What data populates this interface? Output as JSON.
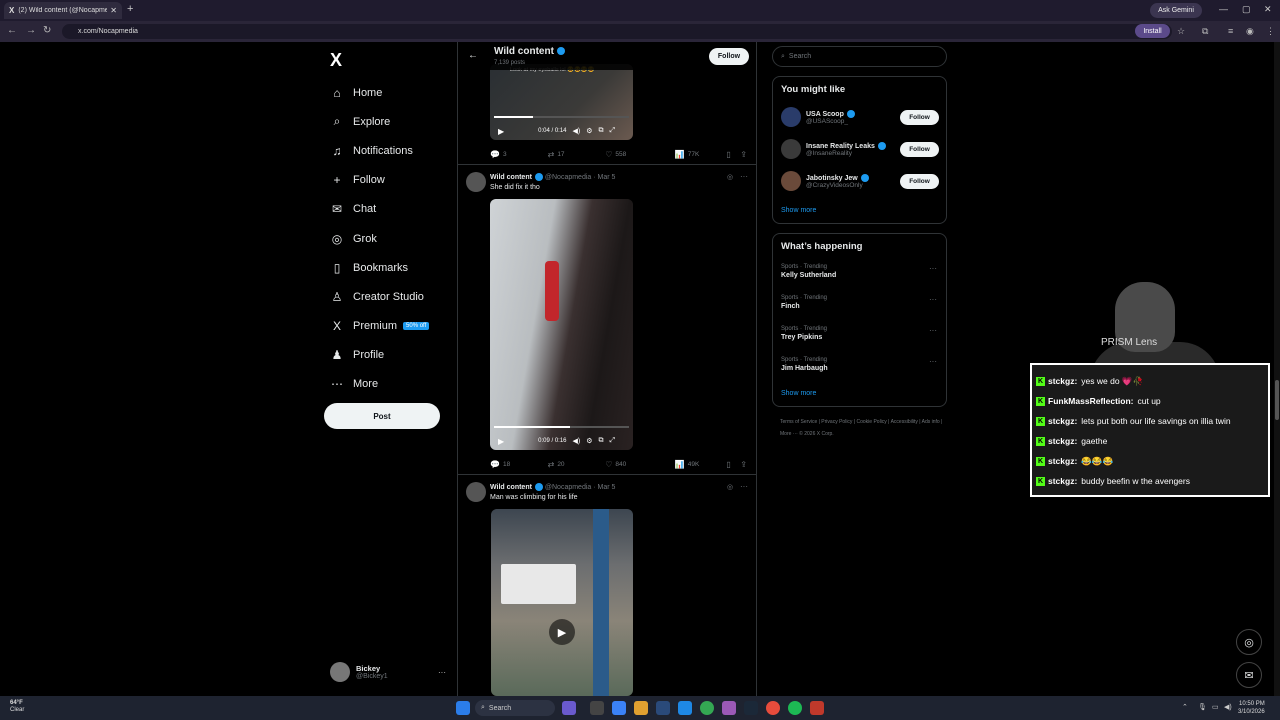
{
  "browser": {
    "tab_title": "(2) Wild content (@Nocapmedia) / X",
    "tab_icon": "X",
    "new_tab": "+",
    "ask_gemini": "Ask Gemini",
    "url": "x.com/Nocapmedia",
    "install": "Install"
  },
  "sidebar": {
    "logo": "X",
    "items": [
      {
        "label": "Home",
        "icon": "⌂"
      },
      {
        "label": "Explore",
        "icon": "⌕"
      },
      {
        "label": "Notifications",
        "icon": "♫"
      },
      {
        "label": "Follow",
        "icon": "+"
      },
      {
        "label": "Chat",
        "icon": "✉"
      },
      {
        "label": "Grok",
        "icon": "◎"
      },
      {
        "label": "Bookmarks",
        "icon": "▯"
      },
      {
        "label": "Creator Studio",
        "icon": "♙"
      },
      {
        "label": "Premium",
        "icon": "X"
      },
      {
        "label": "Profile",
        "icon": "♟"
      },
      {
        "label": "More",
        "icon": "⋯"
      }
    ],
    "premium_badge": "50% off",
    "post_button": "Post",
    "user": {
      "name": "Bickey",
      "handle": "@Bickey1",
      "more": "···"
    }
  },
  "header": {
    "name": "Wild content",
    "posts": "7,139 posts",
    "follow": "Follow",
    "back": "←"
  },
  "tweets": [
    {
      "video_time": "0:04 / 0:14",
      "video_progress": 0.29,
      "caption_overlay": "Look at my eyeballs lol 😂😂😂😂",
      "replies": "3",
      "reposts": "17",
      "likes": "558",
      "views": "77K"
    },
    {
      "name": "Wild content",
      "handle": "@Nocapmedia",
      "date": "Mar 5",
      "text": "She did fix it tho",
      "video_time": "0:09 / 0:16",
      "video_progress": 0.56,
      "replies": "18",
      "reposts": "20",
      "likes": "840",
      "views": "49K"
    },
    {
      "name": "Wild content",
      "handle": "@Nocapmedia",
      "date": "Mar 5",
      "text": "Man was climbing for his life"
    }
  ],
  "right": {
    "search_placeholder": "Search",
    "you_might_like": "You might like",
    "suggestions": [
      {
        "name": "USA Scoop",
        "handle": "@USAScoop_",
        "follow": "Follow"
      },
      {
        "name": "Insane Reality Leaks",
        "handle": "@InsaneReality",
        "follow": "Follow"
      },
      {
        "name": "Jabotinsky Jew",
        "handle": "@CrazyVideosOnly",
        "follow": "Follow"
      }
    ],
    "show_more": "Show more",
    "whats_happening": "What’s happening",
    "trends": [
      {
        "category": "Sports · Trending",
        "title": "Kelly Sutherland"
      },
      {
        "category": "Sports · Trending",
        "title": "Finch"
      },
      {
        "category": "Sports · Trending",
        "title": "Trey Pipkins"
      },
      {
        "category": "Sports · Trending",
        "title": "Jim Harbaugh"
      }
    ],
    "show_more_2": "Show more",
    "footer": "Terms of Service  |  Privacy Policy  |  Cookie Policy  |  Accessibility  |  Ads info  |  More ···  © 2026 X Corp."
  },
  "stream": {
    "brand": "PRISM Lens",
    "chat": [
      {
        "user": "stckgz:",
        "msg": "yes we do 💗🥀"
      },
      {
        "user": "FunkMassReflection:",
        "msg": "cut up"
      },
      {
        "user": "stckgz:",
        "msg": "lets put both our life savings on illia twin"
      },
      {
        "user": "stckgz:",
        "msg": "gaethe"
      },
      {
        "user": "stckgz:",
        "msg": "😂😂😂"
      },
      {
        "user": "stckgz:",
        "msg": "buddy beefin w the avengers"
      }
    ]
  },
  "taskbar": {
    "temp": "64°F",
    "weather": "Clear",
    "search": "Search",
    "time": "10:50 PM",
    "date": "3/10/2026"
  },
  "colors": {
    "accent": "#1d9bf0",
    "bg": "#000000",
    "chat_badge": "#53fc18"
  }
}
